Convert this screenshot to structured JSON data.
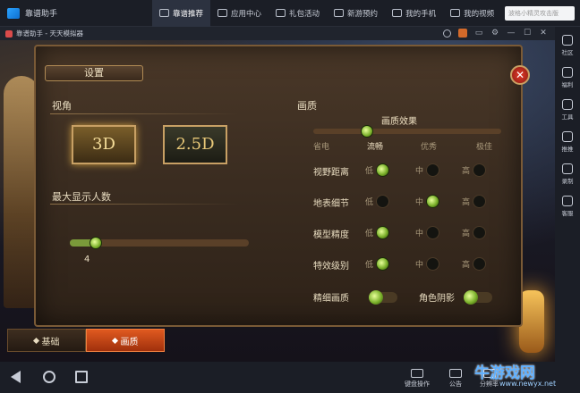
{
  "app": {
    "name": "靠谱助手",
    "nav_tabs": [
      {
        "label": "靠谱推荐",
        "icon": "home-icon",
        "active": true
      },
      {
        "label": "应用中心",
        "icon": "gamepad-icon",
        "active": false
      },
      {
        "label": "礼包活动",
        "icon": "gift-icon",
        "active": false
      },
      {
        "label": "新游预约",
        "icon": "clock-icon",
        "active": false
      },
      {
        "label": "我的手机",
        "icon": "phone-icon",
        "active": false
      },
      {
        "label": "我的视频",
        "icon": "video-icon",
        "active": false
      }
    ],
    "search_placeholder": "波格小精灵攻击版"
  },
  "window": {
    "title": "靠谱助手 - 天天模拟器"
  },
  "settings": {
    "title": "设置",
    "view": {
      "label": "视角",
      "options": [
        "3D",
        "2.5D"
      ],
      "selected": "3D"
    },
    "max_players": {
      "label": "最大显示人数",
      "value": "4",
      "fraction": 0.08
    },
    "quality": {
      "label": "画质",
      "effect_label": "画质效果",
      "effect_fraction": 0.25,
      "levels": [
        "省电",
        "流畅",
        "优秀",
        "极佳"
      ],
      "current_level": "流畅",
      "rows": [
        {
          "label": "视野距离",
          "options": [
            "低",
            "中",
            "高"
          ],
          "selected": 0
        },
        {
          "label": "地表细节",
          "options": [
            "低",
            "中",
            "高"
          ],
          "selected": 1
        },
        {
          "label": "模型精度",
          "options": [
            "低",
            "中",
            "高"
          ],
          "selected": 0
        },
        {
          "label": "特效级别",
          "options": [
            "低",
            "中",
            "高"
          ],
          "selected": 0
        }
      ],
      "toggles": [
        {
          "label": "精细画质",
          "on": true
        },
        {
          "label": "角色阴影",
          "on": true
        }
      ]
    },
    "tabs": [
      {
        "label": "基础",
        "active": false
      },
      {
        "label": "画质",
        "active": true
      }
    ]
  },
  "sidebar": {
    "items": [
      {
        "label": "社区",
        "icon": "community-icon"
      },
      {
        "label": "福利",
        "icon": "gift-icon"
      },
      {
        "label": "工具",
        "icon": "tools-icon"
      },
      {
        "label": "推推",
        "icon": "push-icon"
      },
      {
        "label": "录制",
        "icon": "record-icon"
      },
      {
        "label": "客服",
        "icon": "support-icon"
      }
    ]
  },
  "bottom": {
    "tools": [
      {
        "label": "键盘操作",
        "icon": "keyboard-icon"
      },
      {
        "label": "公告",
        "icon": "notice-icon"
      },
      {
        "label": "分辨率",
        "icon": "resolution-icon"
      }
    ],
    "watermark": "牛游戏网",
    "watermark_url": "www.newyx.net"
  }
}
